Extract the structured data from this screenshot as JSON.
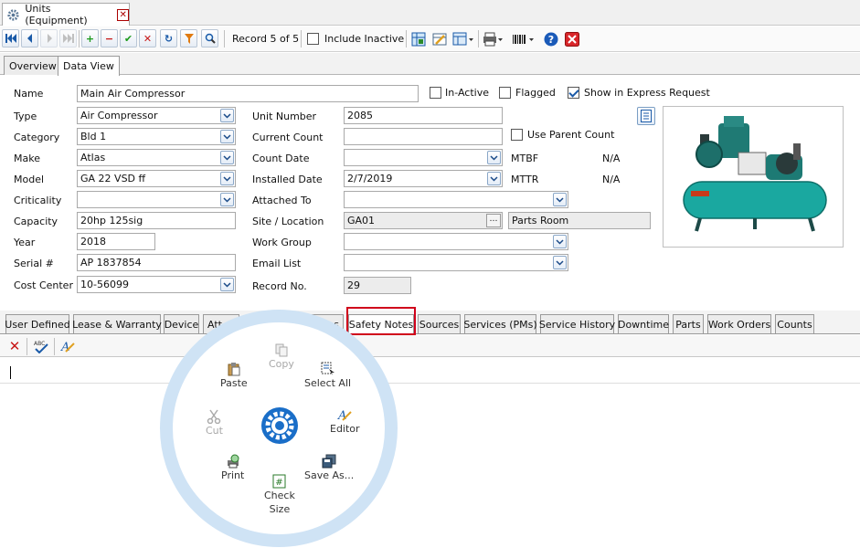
{
  "window": {
    "tab_title": "Units (Equipment)"
  },
  "toolbar": {
    "record_text": "Record 5 of 5",
    "include_inactive_label": "Include Inactive"
  },
  "view_tabs": [
    "Overview",
    "Data View"
  ],
  "form": {
    "name_label": "Name",
    "name_value": "Main Air Compressor",
    "inactive_label": "In-Active",
    "flagged_label": "Flagged",
    "express_label": "Show in Express Request",
    "type_label": "Type",
    "type_value": "Air Compressor",
    "category_label": "Category",
    "category_value": "Bld 1",
    "make_label": "Make",
    "make_value": "Atlas",
    "model_label": "Model",
    "model_value": "GA 22 VSD ff",
    "criticality_label": "Criticality",
    "criticality_value": "",
    "capacity_label": "Capacity",
    "capacity_value": "20hp 125sig",
    "year_label": "Year",
    "year_value": "2018",
    "serial_label": "Serial #",
    "serial_value": "AP 1837854",
    "costcenter_label": "Cost Center",
    "costcenter_value": "10-56099",
    "unitnumber_label": "Unit Number",
    "unitnumber_value": "2085",
    "currentcount_label": "Current Count",
    "currentcount_value": "",
    "useparent_label": "Use Parent Count",
    "countdate_label": "Count Date",
    "countdate_value": "",
    "mtbf_label": "MTBF",
    "mtbf_value": "N/A",
    "installed_label": "Installed Date",
    "installed_value": "2/7/2019",
    "mttr_label": "MTTR",
    "mttr_value": "N/A",
    "attached_label": "Attached To",
    "attached_value": "",
    "site_label": "Site / Location",
    "site_value": "GA01",
    "location_value": "Parts Room",
    "workgroup_label": "Work Group",
    "workgroup_value": "",
    "email_label": "Email List",
    "email_value": "",
    "recordno_label": "Record No.",
    "recordno_value": "29"
  },
  "bottom_tabs": [
    "User Defined",
    "Lease & Warranty",
    "Device",
    "Att",
    "s",
    "Safety Notes",
    "Sources",
    "Services (PMs)",
    "Service History",
    "Downtime",
    "Parts",
    "Work Orders",
    "Counts"
  ],
  "radial_menu": {
    "copy": "Copy",
    "paste": "Paste",
    "select_all": "Select All",
    "cut": "Cut",
    "editor": "Editor",
    "print": "Print",
    "save_as": "Save As...",
    "check_size_1": "Check",
    "check_size_2": "Size"
  },
  "colors": {
    "highlight": "#d0021b",
    "ring": "#cfe3f5",
    "accent_blue": "#1a6ec8"
  }
}
